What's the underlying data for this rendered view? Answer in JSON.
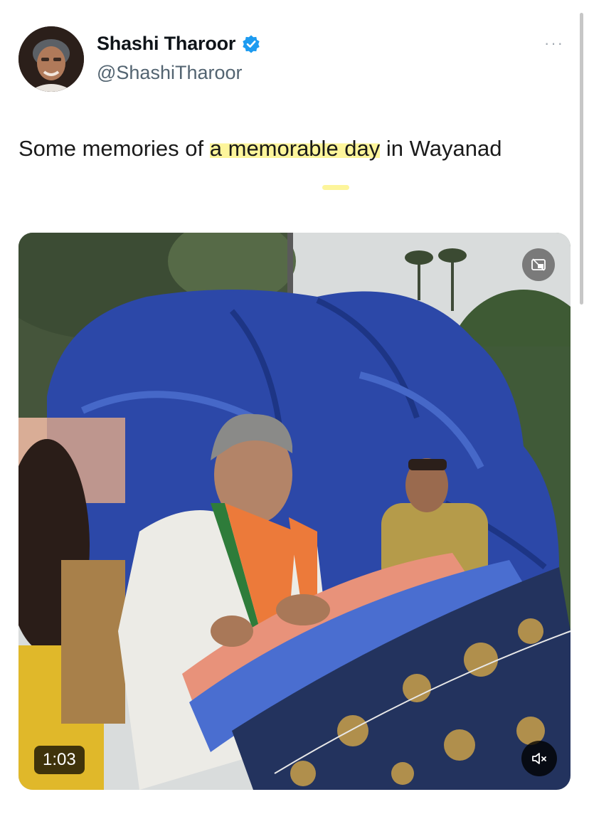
{
  "author": {
    "display_name": "Shashi Tharoor",
    "handle": "@ShashiTharoor",
    "verified_icon": "verified-badge-icon"
  },
  "tweet": {
    "text_before": "Some memories of ",
    "text_highlight": "a memorable day",
    "text_after": " in Wayanad"
  },
  "menu": {
    "more_label": "···"
  },
  "video": {
    "duration": "1:03",
    "pip_icon": "picture-in-picture-icon",
    "mute_icon": "speaker-muted-icon"
  },
  "colors": {
    "highlight": "#fdf59b",
    "verified": "#1d9bf0",
    "secondary_text": "#536471"
  }
}
